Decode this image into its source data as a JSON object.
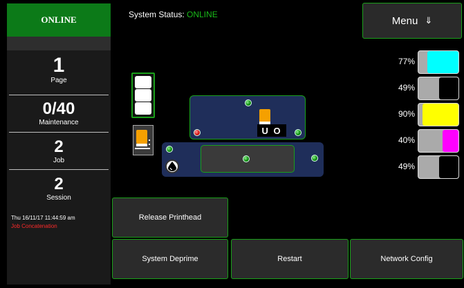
{
  "status_panel": {
    "online_label": "ONLINE",
    "page_count": "1",
    "page_label": "Page",
    "maintenance_count": "0/40",
    "maintenance_label": "Maintenance",
    "job_count": "2",
    "job_label": "Job",
    "session_count": "2",
    "session_label": "Session",
    "datetime": "Thu 16/11/17 11:44:59 am",
    "mode": "Job Concatenation"
  },
  "header": {
    "system_status_label": "System Status:",
    "system_status_value": "ONLINE",
    "menu_label": "Menu",
    "menu_icon": "⇓"
  },
  "printer": {
    "head_text": "U O"
  },
  "ink": [
    {
      "percent": "77%",
      "level": 0.77,
      "color": "#00ffff"
    },
    {
      "percent": "49%",
      "level": 0.49,
      "color": "#000000"
    },
    {
      "percent": "90%",
      "level": 0.9,
      "color": "#ffff00"
    },
    {
      "percent": "40%",
      "level": 0.4,
      "color": "#ff00ff"
    },
    {
      "percent": "49%",
      "level": 0.49,
      "color": "#000000"
    }
  ],
  "buttons": {
    "release_printhead": "Release Printhead",
    "system_deprime": "System Deprime",
    "restart": "Restart",
    "network_config": "Network Config"
  },
  "colors": {
    "accent": "#19a019",
    "online_bg": "#0c7a18",
    "error": "#ff2a2a"
  }
}
